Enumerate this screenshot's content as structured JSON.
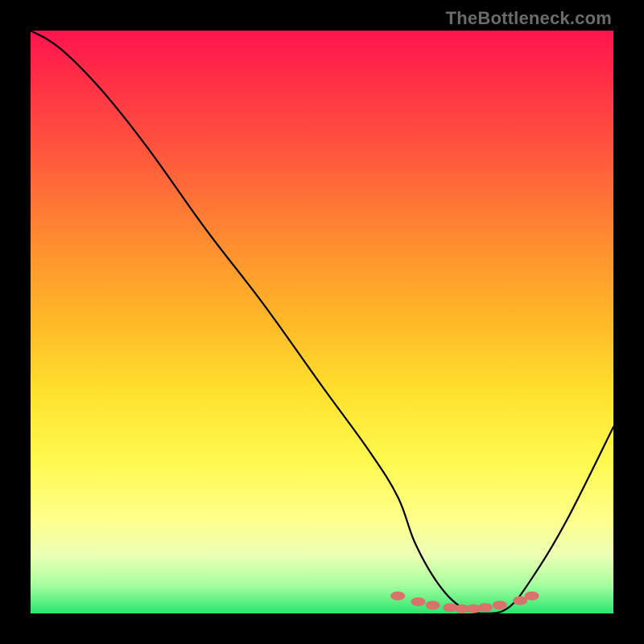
{
  "watermark": "TheBottleneck.com",
  "chart_data": {
    "type": "line",
    "title": "",
    "xlabel": "",
    "ylabel": "",
    "xlim": [
      0,
      100
    ],
    "ylim": [
      0,
      100
    ],
    "series": [
      {
        "name": "bottleneck-curve",
        "x": [
          0,
          5,
          12,
          20,
          30,
          40,
          50,
          58,
          63,
          66,
          70,
          74,
          78,
          82,
          86,
          92,
          100
        ],
        "values": [
          100,
          97,
          90,
          80,
          66,
          53,
          39,
          28,
          20,
          12,
          5,
          1,
          0,
          1,
          6,
          16,
          32
        ]
      }
    ],
    "markers": {
      "name": "optimal-range-dots",
      "color": "#d9726b",
      "x": [
        63,
        66.5,
        69,
        72,
        74,
        76,
        78,
        80.5,
        84,
        86
      ],
      "values": [
        3.0,
        2.0,
        1.4,
        1.0,
        0.8,
        0.8,
        1.0,
        1.4,
        2.2,
        3.0
      ]
    },
    "background_gradient": {
      "top_color": "#ff144e",
      "mid_color": "#ffe228",
      "bottom_color": "#28e66e"
    }
  }
}
